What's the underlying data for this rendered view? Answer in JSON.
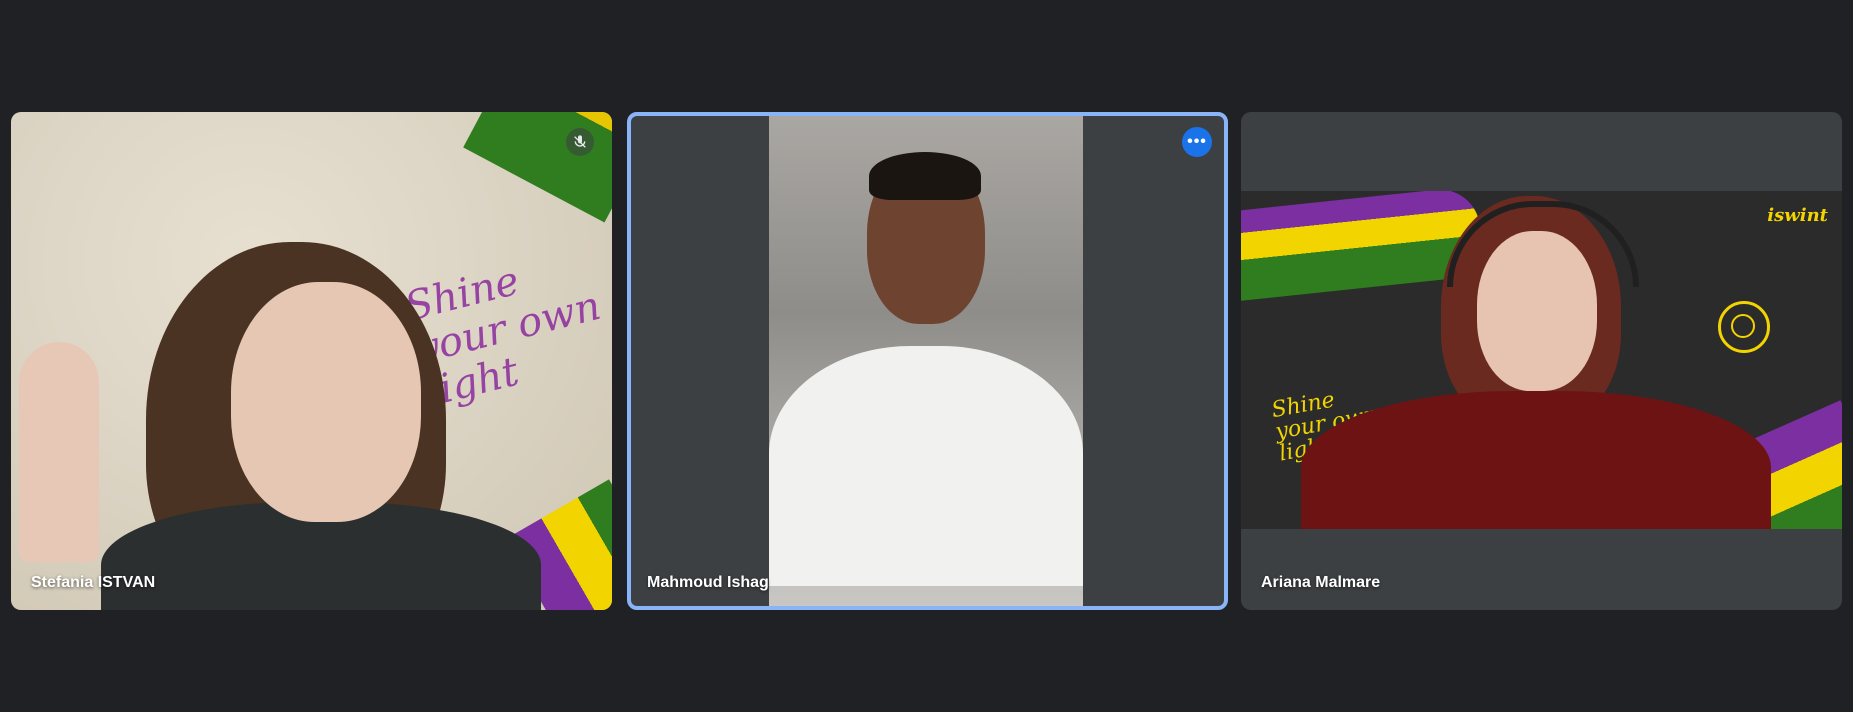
{
  "participants": [
    {
      "name": "Stefania ISTVAN",
      "muted": true
    },
    {
      "name": "Mahmoud Ishag",
      "active_speaker": true
    },
    {
      "name": "Ariana Malmare"
    }
  ],
  "backgrounds": {
    "tile1_text": "Shine your own light",
    "tile3_logo": "iswint",
    "tile3_text": "Shine your own light"
  },
  "colors": {
    "page_bg": "#202124",
    "tile_bg": "#3c4043",
    "active_border": "#8ab4f8",
    "more_button": "#1a73e8",
    "ribbon_purple": "#7b2fa0",
    "ribbon_yellow": "#f2d400",
    "ribbon_green": "#2f7d1e"
  },
  "icons": {
    "mute": "mic-off-icon",
    "more": "more-options-icon"
  }
}
